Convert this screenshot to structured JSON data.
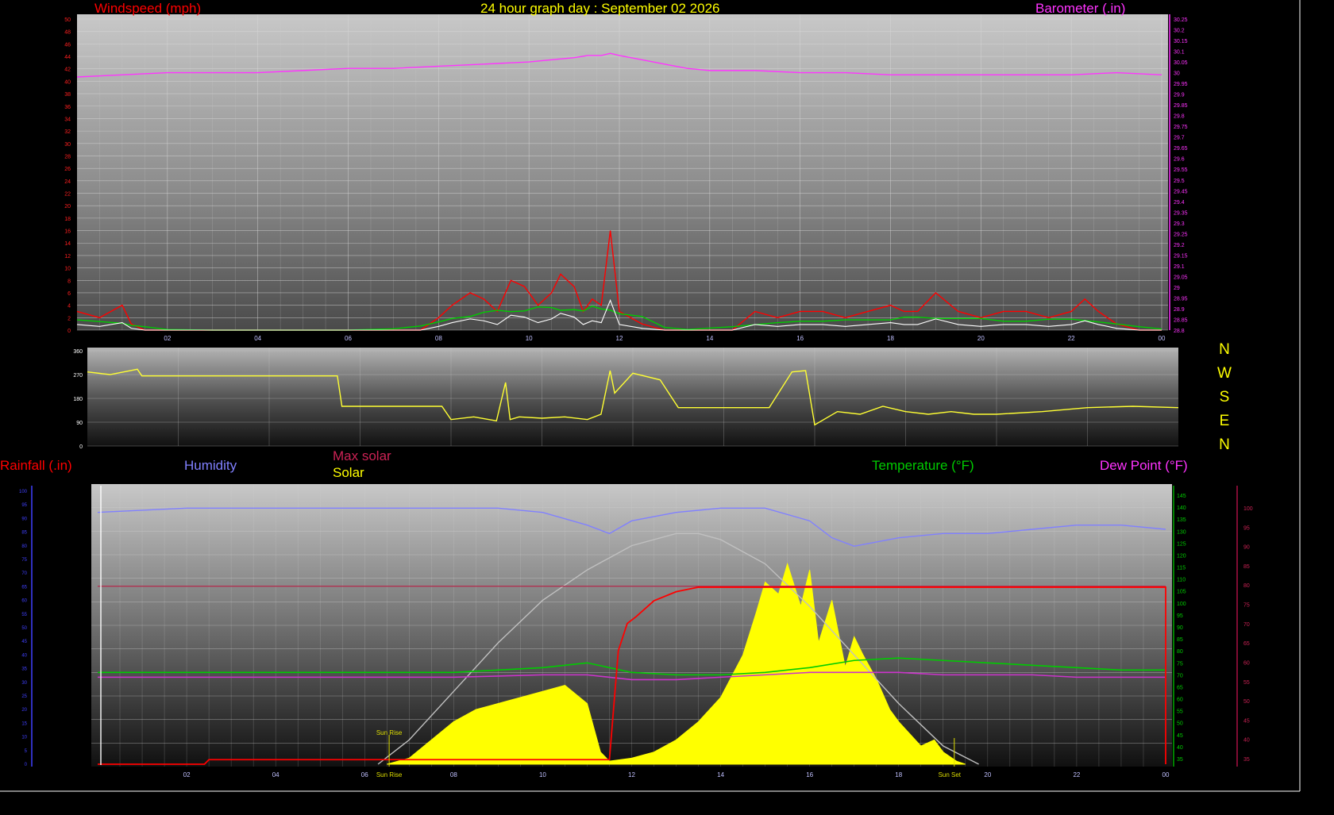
{
  "title": "24 hour graph day : September 02 2026",
  "colors": {
    "windspeed": "#ff0000",
    "gust": "#ffffff",
    "avg_wind": "#00cc00",
    "barometer": "#ff33ff",
    "direction": "#ffff33",
    "humidity": "#8080ff",
    "max_solar": "#c0c0c0",
    "solar": "#ffff00",
    "temperature": "#00cc00",
    "dew_point": "#cc33cc",
    "rainfall": "#ff0000",
    "maxsolar_label": "#cc2255",
    "title": "#ffff00"
  },
  "panel1": {
    "left_label": "Windspeed (mph)",
    "right_label": "Barometer (.in)",
    "x_ticks": [
      "02",
      "04",
      "06",
      "08",
      "10",
      "12",
      "14",
      "16",
      "18",
      "20",
      "22",
      "00"
    ],
    "y_left_ticks": [
      "0",
      "2",
      "4",
      "6",
      "8",
      "10",
      "12",
      "14",
      "16",
      "18",
      "20",
      "22",
      "24",
      "26",
      "28",
      "30",
      "32",
      "34",
      "36",
      "38",
      "40",
      "42",
      "44",
      "46",
      "48",
      "50"
    ],
    "y_right_ticks": [
      "28.8",
      "28.85",
      "28.9",
      "28.95",
      "29",
      "29.05",
      "29.1",
      "29.15",
      "29.2",
      "29.25",
      "29.3",
      "29.35",
      "29.4",
      "29.45",
      "29.5",
      "29.55",
      "29.6",
      "29.65",
      "29.7",
      "29.75",
      "29.8",
      "29.85",
      "29.9",
      "29.95",
      "30",
      "30.05",
      "30.1",
      "30.15",
      "30.2",
      "30.25"
    ]
  },
  "panel2": {
    "y_ticks": [
      "0",
      "90",
      "180",
      "270",
      "360"
    ],
    "compass": [
      "N",
      "W",
      "S",
      "E",
      "N"
    ]
  },
  "panel3": {
    "labels": {
      "rainfall": "Rainfall (.in)",
      "humidity": "Humidity",
      "max_solar": "Max solar",
      "solar": "Solar",
      "temperature": "Temperature (°F)",
      "dew_point": "Dew Point (°F)"
    },
    "x_ticks": [
      "02",
      "04",
      "06",
      "08",
      "10",
      "12",
      "14",
      "16",
      "18",
      "20",
      "22",
      "00"
    ],
    "sun_rise_label": "Sun Rise",
    "sun_set_label": "Sun Set",
    "y_temp_ticks": [
      "35",
      "40",
      "45",
      "50",
      "55",
      "60",
      "65",
      "70",
      "75",
      "80",
      "85",
      "90",
      "95",
      "100",
      "105",
      "110",
      "115",
      "120",
      "125",
      "130",
      "135",
      "140",
      "145"
    ],
    "y_dew_ticks": [
      "35",
      "40",
      "45",
      "50",
      "55",
      "60",
      "65",
      "70",
      "75",
      "80",
      "85",
      "90",
      "95",
      "100"
    ]
  },
  "chart_data": [
    {
      "type": "line",
      "title": "24 hour graph day : September 02 2026",
      "x_unit": "hour",
      "xlim": [
        0,
        24
      ],
      "series": [
        {
          "name": "Windspeed (mph)",
          "axis": "left",
          "x": [
            0,
            0.5,
            1,
            1.2,
            1.5,
            2,
            3,
            4,
            5,
            6,
            7,
            7.6,
            8,
            8.3,
            8.7,
            9,
            9.3,
            9.6,
            9.9,
            10.2,
            10.5,
            10.7,
            11,
            11.2,
            11.4,
            11.6,
            11.8,
            12,
            12.5,
            13,
            13.5,
            14,
            14.5,
            15,
            15.5,
            16,
            16.5,
            17,
            17.5,
            18,
            18.3,
            18.6,
            19,
            19.5,
            20,
            20.5,
            21,
            21.5,
            22,
            22.3,
            22.6,
            23,
            23.5,
            24
          ],
          "values": [
            3,
            2,
            4,
            1,
            0,
            0,
            0,
            0,
            0,
            0,
            0,
            0,
            2,
            4,
            6,
            5,
            3,
            8,
            7,
            4,
            6,
            9,
            7,
            3,
            5,
            4,
            16,
            3,
            1,
            0,
            0,
            0,
            0,
            3,
            2,
            3,
            3,
            2,
            3,
            4,
            3,
            3,
            6,
            3,
            2,
            3,
            3,
            2,
            3,
            5,
            3,
            1,
            0,
            0
          ]
        },
        {
          "name": "Barometer (.in)",
          "axis": "right",
          "x": [
            0,
            1,
            2,
            3,
            4,
            5,
            6,
            7,
            8,
            9,
            10,
            10.5,
            11,
            11.3,
            11.6,
            11.8,
            12,
            12.5,
            13,
            13.5,
            14,
            15,
            16,
            17,
            18,
            19,
            20,
            21,
            22,
            23,
            24
          ],
          "values": [
            29.98,
            29.99,
            30.0,
            30.0,
            30.0,
            30.01,
            30.02,
            30.02,
            30.03,
            30.04,
            30.05,
            30.06,
            30.07,
            30.08,
            30.08,
            30.09,
            30.08,
            30.06,
            30.04,
            30.02,
            30.01,
            30.01,
            30.0,
            30.0,
            29.99,
            29.99,
            29.99,
            29.99,
            29.99,
            30.0,
            29.99
          ]
        }
      ],
      "ylim_left": [
        0,
        50
      ],
      "ylim_right": [
        28.8,
        30.25
      ],
      "grid": true
    },
    {
      "type": "line",
      "title": "",
      "x_unit": "hour",
      "xlim": [
        0,
        24
      ],
      "ylim": [
        0,
        360
      ],
      "series": [
        {
          "name": "Wind direction",
          "x": [
            0,
            0.5,
            1.1,
            1.2,
            2,
            3,
            5.5,
            5.6,
            7,
            7.8,
            8,
            8.5,
            9,
            9.2,
            9.3,
            9.5,
            10,
            10.5,
            11,
            11.3,
            11.5,
            11.6,
            12,
            12.6,
            13,
            14,
            14.6,
            15,
            15.5,
            15.8,
            16,
            16.5,
            17,
            17.5,
            18,
            18.5,
            19,
            19.5,
            20,
            21,
            22,
            23,
            24
          ],
          "values": [
            280,
            270,
            290,
            265,
            265,
            265,
            265,
            150,
            150,
            150,
            100,
            110,
            95,
            240,
            100,
            110,
            105,
            110,
            100,
            120,
            285,
            200,
            275,
            250,
            145,
            145,
            145,
            145,
            280,
            285,
            80,
            130,
            120,
            150,
            130,
            120,
            130,
            120,
            120,
            130,
            145,
            150,
            145
          ]
        }
      ],
      "grid": true
    },
    {
      "type": "area",
      "title": "",
      "x_unit": "hour",
      "xlim": [
        0,
        24
      ],
      "series": [
        {
          "name": "Solar",
          "axis": "solar",
          "x": [
            6.5,
            7,
            7.5,
            8,
            8.5,
            9,
            9.5,
            10,
            10.5,
            11,
            11.3,
            11.5,
            12,
            12.5,
            13,
            13.5,
            14,
            14.5,
            14.8,
            15,
            15.3,
            15.5,
            15.8,
            16,
            16.2,
            16.5,
            16.8,
            17,
            17.2,
            17.5,
            17.8,
            18,
            18.5,
            18.8,
            19,
            19.3,
            19.5
          ],
          "values": [
            0,
            10,
            40,
            70,
            90,
            100,
            110,
            120,
            130,
            100,
            20,
            5,
            10,
            20,
            40,
            70,
            110,
            180,
            250,
            300,
            280,
            330,
            260,
            320,
            200,
            270,
            160,
            210,
            180,
            140,
            90,
            70,
            30,
            40,
            20,
            5,
            0
          ]
        },
        {
          "name": "Max solar",
          "axis": "solar",
          "x": [
            6.3,
            7,
            8,
            9,
            10,
            11,
            12,
            13,
            13.5,
            14,
            15,
            16,
            17,
            18,
            19,
            19.8
          ],
          "values": [
            0,
            40,
            120,
            200,
            270,
            320,
            360,
            380,
            380,
            370,
            330,
            260,
            180,
            100,
            30,
            0
          ]
        },
        {
          "name": "Humidity",
          "axis": "humidity",
          "x": [
            0,
            2,
            4,
            6,
            8,
            9,
            10,
            11,
            11.5,
            12,
            13,
            14,
            15,
            16,
            16.5,
            17,
            18,
            19,
            20,
            21,
            22,
            23,
            24
          ],
          "values": [
            98,
            99,
            99,
            99,
            99,
            99,
            98,
            95,
            93,
            96,
            98,
            99,
            99,
            96,
            92,
            90,
            92,
            93,
            93,
            94,
            95,
            95,
            94
          ]
        },
        {
          "name": "Temperature (°F)",
          "axis": "temp",
          "x": [
            0,
            2,
            4,
            6,
            8,
            9,
            10,
            11,
            11.5,
            12,
            13,
            14,
            15,
            16,
            17,
            18,
            19,
            20,
            21,
            22,
            23,
            24
          ],
          "values": [
            71,
            71,
            71,
            71,
            71,
            72,
            73,
            75,
            73,
            71,
            70,
            70,
            71,
            73,
            76,
            77,
            76,
            75,
            74,
            73,
            72,
            72
          ]
        },
        {
          "name": "Dew Point (°F)",
          "axis": "temp",
          "x": [
            0,
            2,
            4,
            6,
            8,
            10,
            11,
            12,
            13,
            14,
            15,
            16,
            17,
            18,
            19,
            20,
            21,
            22,
            23,
            24
          ],
          "values": [
            69,
            69,
            69,
            69,
            69,
            70,
            70,
            68,
            68,
            69,
            70,
            71,
            71,
            71,
            70,
            70,
            70,
            69,
            69,
            69
          ]
        },
        {
          "name": "Rainfall (.in)",
          "axis": "rain",
          "x": [
            0,
            2.4,
            2.5,
            6.5,
            6.6,
            11.5,
            11.7,
            11.9,
            12.1,
            12.5,
            13,
            13.5,
            24,
            24
          ],
          "values": [
            0,
            0,
            0.02,
            0.02,
            0.02,
            0.02,
            0.5,
            0.62,
            0.65,
            0.72,
            0.76,
            0.78,
            0.78,
            0
          ]
        }
      ],
      "grid": true
    }
  ]
}
